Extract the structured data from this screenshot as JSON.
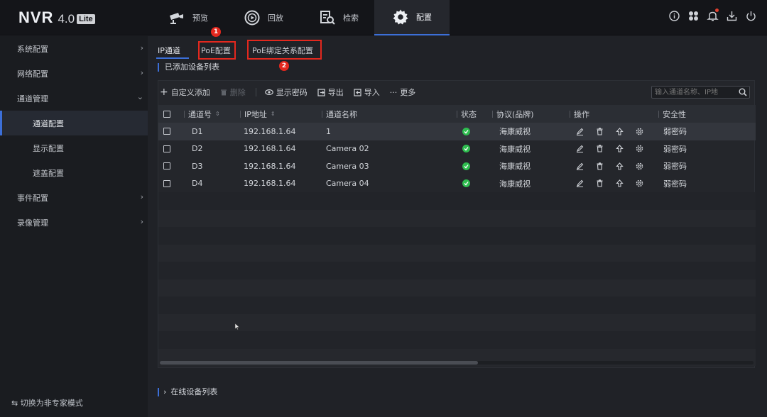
{
  "app": {
    "name": "NVR",
    "version": "4.0",
    "edition": "Lite"
  },
  "topnav": [
    {
      "label": "预览",
      "icon": "camera-icon"
    },
    {
      "label": "回放",
      "icon": "playback-icon"
    },
    {
      "label": "检索",
      "icon": "search-file-icon"
    },
    {
      "label": "配置",
      "icon": "gear-icon",
      "active": true
    }
  ],
  "topicons": [
    "info-icon",
    "fan-icon",
    "bell-icon",
    "download-icon",
    "power-icon"
  ],
  "sidebar": {
    "items": [
      {
        "label": "系统配置"
      },
      {
        "label": "网络配置"
      },
      {
        "label": "通道管理"
      },
      {
        "label": "通道配置",
        "active": true
      },
      {
        "label": "显示配置"
      },
      {
        "label": "遮盖配置"
      },
      {
        "label": "事件配置"
      },
      {
        "label": "录像管理"
      }
    ],
    "mode_switch": "切换为非专家模式"
  },
  "subtabs": [
    "IP通道",
    "PoE配置",
    "PoE绑定关系配置"
  ],
  "annotations": [
    "1",
    "2"
  ],
  "section_title": "已添加设备列表",
  "toolbar": {
    "add": "自定义添加",
    "delete": "删除",
    "show_password": "显示密码",
    "export": "导出",
    "import": "导入",
    "more": "更多"
  },
  "search": {
    "placeholder": "输入通道名称、IP地"
  },
  "table": {
    "headers": [
      "通道号",
      "IP地址",
      "通道名称",
      "状态",
      "协议(品牌)",
      "操作",
      "安全性"
    ],
    "rows": [
      {
        "channel": "D1",
        "ip": "192.168.1.64",
        "name": "1",
        "protocol": "海康威视",
        "security": "弱密码"
      },
      {
        "channel": "D2",
        "ip": "192.168.1.64",
        "name": "Camera 02",
        "protocol": "海康威视",
        "security": "弱密码"
      },
      {
        "channel": "D3",
        "ip": "192.168.1.64",
        "name": "Camera 03",
        "protocol": "海康威视",
        "security": "弱密码"
      },
      {
        "channel": "D4",
        "ip": "192.168.1.64",
        "name": "Camera 04",
        "protocol": "海康威视",
        "security": "弱密码"
      }
    ]
  },
  "online_list": "在线设备列表",
  "colors": {
    "accent": "#3c6fd8",
    "annotation": "#e3281e",
    "status_ok": "#2ebd4f"
  }
}
